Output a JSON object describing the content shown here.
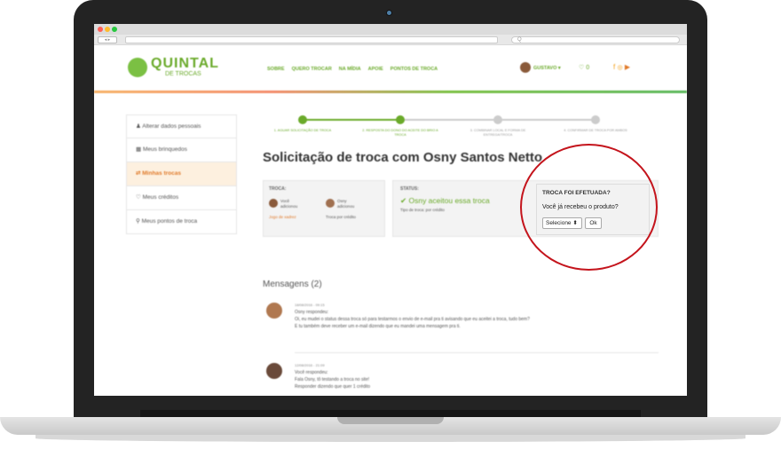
{
  "colors": {
    "accent_green": "#6aaa2a",
    "accent_orange": "#e07a2a",
    "highlight_circle": "#c4141c"
  },
  "browser": {
    "search_placeholder": "Q"
  },
  "header": {
    "logo_title": "QUINTAL",
    "logo_subtitle": "DE TROCAS",
    "menu": [
      "SOBRE",
      "QUERO TROCAR",
      "NA MÍDIA",
      "APOIE",
      "PONTOS DE TROCA"
    ],
    "user_name": "GUSTAVO ▾",
    "likes": "♡ 0"
  },
  "sidebar": {
    "items": [
      {
        "icon": "user-icon",
        "label": "Alterar dados pessoais"
      },
      {
        "icon": "toys-icon",
        "label": "Meus brinquedos"
      },
      {
        "icon": "exchange-icon",
        "label": "Minhas trocas"
      },
      {
        "icon": "heart-icon",
        "label": "Meus créditos"
      },
      {
        "icon": "pin-icon",
        "label": "Meus pontos de troca"
      }
    ]
  },
  "steps": [
    "1. AGUAR SOLICITAÇÃO DE TROCA",
    "2. RESPOSTA DO DONO DO ACEITE DO BRIO A TROCA",
    "3. COMBINAR LOCAL E FORMA DE ENTREGA/TROCA",
    "4. CONFIRMAR DE TROCA POR AMBOS"
  ],
  "page_title": "Solicitação de troca com Osny Santos Netto",
  "troca": {
    "label": "TROCA:",
    "you": "Você",
    "you_sub": "adicionou",
    "other": "Osny",
    "other_sub": "adicionou",
    "item_link": "Jogo de xadrez",
    "item_other": "Troca por crédito"
  },
  "status": {
    "label": "STATUS:",
    "text": "✔ Osny aceitou essa troca",
    "type": "Tipo de troca: por crédito"
  },
  "popup": {
    "title": "TROCA FOI EFETUADA?",
    "question": "Você já recebeu o produto?",
    "select_value": "Selecione ⬍",
    "ok_label": "Ok"
  },
  "messages": {
    "title": "Mensagens (2)",
    "items": [
      {
        "date": "18/08/2016 - 09:15",
        "author": "Osny respondeu:",
        "lines": [
          "Oi, eu mudei o status dessa troca só para testarmos o envio de e-mail pra ti avisando que eu aceitei a troca, tudo bem?",
          "E tu também deve receber um e-mail dizendo que eu mandei uma mensagem pra ti."
        ]
      },
      {
        "date": "12/08/2016 - 21:09",
        "author": "Você respondeu:",
        "lines": [
          "Fala Osny, tô testando a troca no site!",
          "Responder dizendo que quer 1 crédito"
        ]
      }
    ]
  }
}
